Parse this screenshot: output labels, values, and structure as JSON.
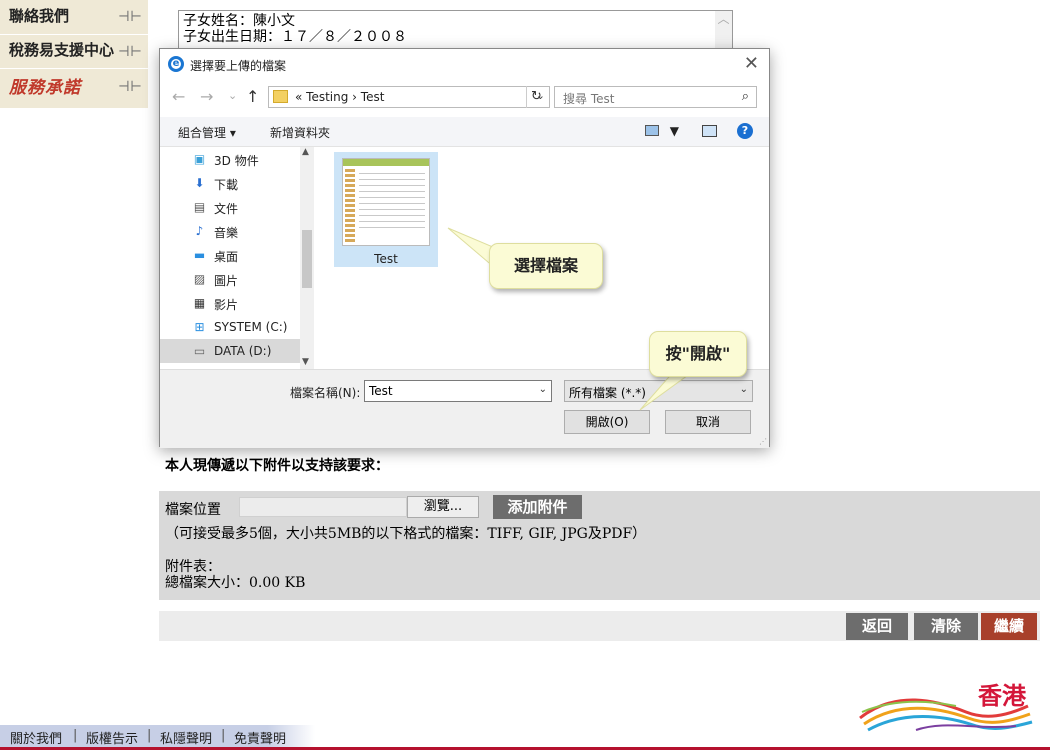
{
  "nav": {
    "items": [
      {
        "label": "聯絡我們",
        "arrow": "⊣⊢"
      },
      {
        "label": "稅務易支援中心",
        "arrow": "⊣⊢"
      },
      {
        "label": "服務承諾",
        "arrow": "⊣⊢"
      }
    ]
  },
  "child_info": {
    "line1": "子女姓名：陳小文",
    "line2": "子女出生日期：１７／８／２００８"
  },
  "dialog": {
    "title": "選擇要上傳的檔案",
    "close": "✕",
    "back": "←",
    "forward": "→",
    "recent": "⌄",
    "up": "↑",
    "breadcrumb": "«  Testing  ›  Test",
    "address_dropdown": "⌄",
    "refresh": "↻",
    "search_placeholder": "搜尋 Test",
    "search_icon": "⌕",
    "organize": "組合管理 ▾",
    "new_folder": "新增資料夾",
    "view_dropdown": "▼",
    "help": "?",
    "tree_up": "▲",
    "tree_down": "▼",
    "tree": [
      {
        "icon": "▣",
        "label": "3D 物件",
        "color": "#3aa0d8"
      },
      {
        "icon": "⬇",
        "label": "下載",
        "color": "#2a6fd0"
      },
      {
        "icon": "▤",
        "label": "文件",
        "color": "#555"
      },
      {
        "icon": "♪",
        "label": "音樂",
        "color": "#2a6fd0"
      },
      {
        "icon": "▬",
        "label": "桌面",
        "color": "#2a8fe0"
      },
      {
        "icon": "▨",
        "label": "圖片",
        "color": "#555"
      },
      {
        "icon": "▦",
        "label": "影片",
        "color": "#333"
      },
      {
        "icon": "⊞",
        "label": "SYSTEM (C:)",
        "color": "#2a8fe0"
      },
      {
        "icon": "▭",
        "label": "DATA (D:)",
        "color": "#666"
      },
      {
        "icon": "…",
        "label": "…",
        "color": "#666"
      }
    ],
    "file_name": "Test",
    "filename_label": "檔案名稱(N):",
    "filename_value": "Test",
    "filename_dropdown": "⌄",
    "filetype_value": "所有檔案 (*.*)",
    "filetype_dropdown": "⌄",
    "open_button": "開啟(O)",
    "cancel_button": "取消",
    "grip": "⋰"
  },
  "callouts": {
    "select_file": "選擇檔案",
    "press_open": "按\"開啟\""
  },
  "main": {
    "request_text": "本人現傳遞以下附件以支持該要求：",
    "file_location_label": "檔案位置",
    "browse_button": "瀏覽...",
    "add_attachment_button": "添加附件",
    "accepted_note": "（可接受最多5個，大小共5MB的以下格式的檔案：TIFF, GIF, JPG及PDF）",
    "attachment_list_label": "附件表：",
    "total_size": "總檔案大小：0.00 KB"
  },
  "actions": {
    "back": "返回",
    "clear": "清除",
    "continue": "繼續"
  },
  "footer": {
    "links": [
      "關於我們",
      "版權告示",
      "私隱聲明",
      "免責聲明"
    ],
    "separator": "|"
  },
  "logo": {
    "text": "香港"
  },
  "colors": {
    "nav_bg": "#efe9d6",
    "panel_bg": "#d9d9d9",
    "button_gray": "#6d6d6d",
    "continue_red": "#a8402b",
    "footer_line": "#b5122e"
  }
}
